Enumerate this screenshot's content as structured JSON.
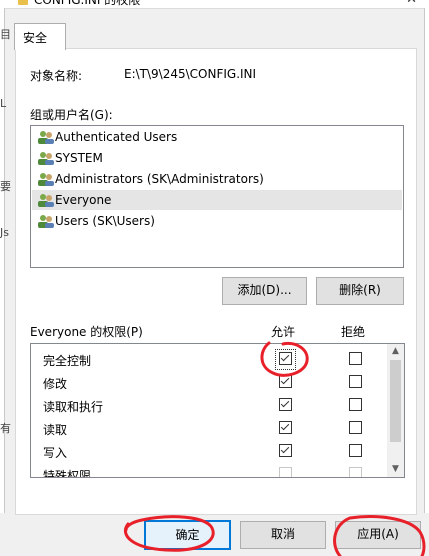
{
  "window": {
    "title": "CONFIG.INI 的权限",
    "close_glyph": "✕"
  },
  "tab": {
    "label": "安全"
  },
  "object": {
    "label": "对象名称:",
    "value": "E:\\T\\9\\245\\CONFIG.INI"
  },
  "groups": {
    "label": "组或用户名(G):",
    "items": [
      {
        "label": "Authenticated Users",
        "selected": false
      },
      {
        "label": "SYSTEM",
        "selected": false
      },
      {
        "label": "Administrators (SK\\Administrators)",
        "selected": false
      },
      {
        "label": "Everyone",
        "selected": true
      },
      {
        "label": "Users (SK\\Users)",
        "selected": false
      }
    ]
  },
  "buttons": {
    "add": "添加(D)...",
    "remove": "删除(R)",
    "ok": "确定",
    "cancel": "取消",
    "apply": "应用(A)"
  },
  "permissions": {
    "label": "Everyone 的权限(P)",
    "allow_header": "允许",
    "deny_header": "拒绝",
    "rows": [
      {
        "name": "完全控制",
        "allow": true,
        "deny": false
      },
      {
        "name": "修改",
        "allow": true,
        "deny": false
      },
      {
        "name": "读取和执行",
        "allow": true,
        "deny": false
      },
      {
        "name": "读取",
        "allow": true,
        "deny": false
      },
      {
        "name": "写入",
        "allow": true,
        "deny": false
      },
      {
        "name": "特殊权限",
        "allow": false,
        "deny": false
      }
    ]
  },
  "background_ghost_text": [
    "目",
    "L",
    "要",
    "Js",
    "有"
  ],
  "colors": {
    "annotation_red": "#e8202a",
    "accent_blue": "#0078d7"
  },
  "icons": [
    "folder-icon",
    "users-group-icon",
    "chevron-up-icon",
    "chevron-down-icon",
    "close-icon"
  ]
}
